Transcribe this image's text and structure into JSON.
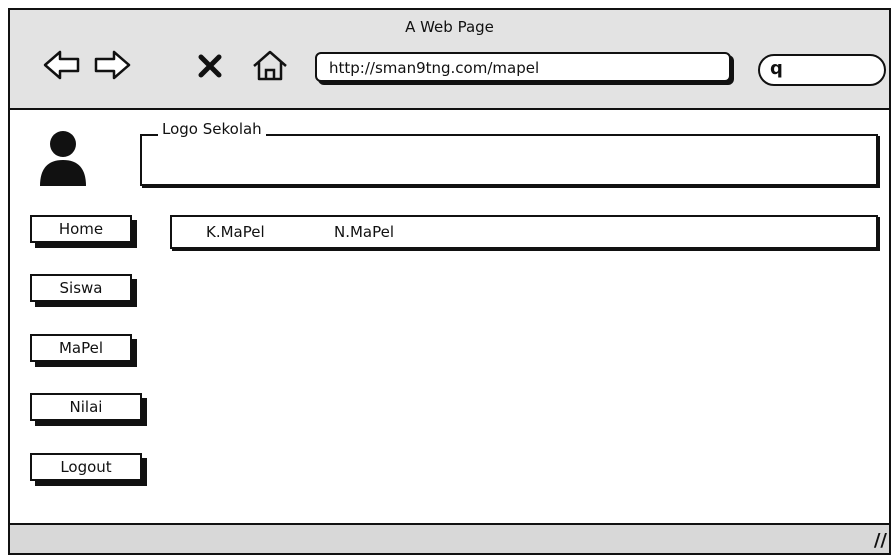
{
  "window": {
    "title": "A Web Page"
  },
  "toolbar": {
    "url": "http://sman9tng.com/mapel",
    "search_glyph": "q",
    "icons": [
      "back-arrow-icon",
      "forward-arrow-icon",
      "close-icon",
      "home-icon",
      "search-icon"
    ]
  },
  "header": {
    "logo_label": "Logo Sekolah",
    "avatar_icon": "user-avatar-icon"
  },
  "sidebar": {
    "items": [
      {
        "label": "Home"
      },
      {
        "label": "Siswa"
      },
      {
        "label": "MaPel"
      },
      {
        "label": "Nilai"
      },
      {
        "label": "Logout"
      }
    ]
  },
  "table": {
    "columns": [
      "K.MaPel",
      "N.MaPel"
    ]
  },
  "statusbar": {
    "resize_glyph": "//"
  }
}
